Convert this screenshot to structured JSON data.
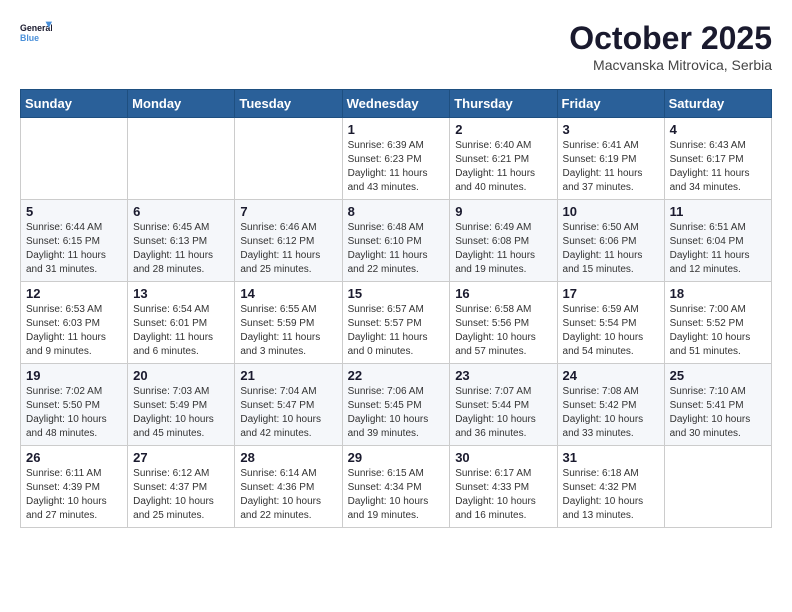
{
  "header": {
    "logo_line1": "General",
    "logo_line2": "Blue",
    "month": "October 2025",
    "location": "Macvanska Mitrovica, Serbia"
  },
  "weekdays": [
    "Sunday",
    "Monday",
    "Tuesday",
    "Wednesday",
    "Thursday",
    "Friday",
    "Saturday"
  ],
  "weeks": [
    [
      {
        "day": "",
        "info": ""
      },
      {
        "day": "",
        "info": ""
      },
      {
        "day": "",
        "info": ""
      },
      {
        "day": "1",
        "info": "Sunrise: 6:39 AM\nSunset: 6:23 PM\nDaylight: 11 hours\nand 43 minutes."
      },
      {
        "day": "2",
        "info": "Sunrise: 6:40 AM\nSunset: 6:21 PM\nDaylight: 11 hours\nand 40 minutes."
      },
      {
        "day": "3",
        "info": "Sunrise: 6:41 AM\nSunset: 6:19 PM\nDaylight: 11 hours\nand 37 minutes."
      },
      {
        "day": "4",
        "info": "Sunrise: 6:43 AM\nSunset: 6:17 PM\nDaylight: 11 hours\nand 34 minutes."
      }
    ],
    [
      {
        "day": "5",
        "info": "Sunrise: 6:44 AM\nSunset: 6:15 PM\nDaylight: 11 hours\nand 31 minutes."
      },
      {
        "day": "6",
        "info": "Sunrise: 6:45 AM\nSunset: 6:13 PM\nDaylight: 11 hours\nand 28 minutes."
      },
      {
        "day": "7",
        "info": "Sunrise: 6:46 AM\nSunset: 6:12 PM\nDaylight: 11 hours\nand 25 minutes."
      },
      {
        "day": "8",
        "info": "Sunrise: 6:48 AM\nSunset: 6:10 PM\nDaylight: 11 hours\nand 22 minutes."
      },
      {
        "day": "9",
        "info": "Sunrise: 6:49 AM\nSunset: 6:08 PM\nDaylight: 11 hours\nand 19 minutes."
      },
      {
        "day": "10",
        "info": "Sunrise: 6:50 AM\nSunset: 6:06 PM\nDaylight: 11 hours\nand 15 minutes."
      },
      {
        "day": "11",
        "info": "Sunrise: 6:51 AM\nSunset: 6:04 PM\nDaylight: 11 hours\nand 12 minutes."
      }
    ],
    [
      {
        "day": "12",
        "info": "Sunrise: 6:53 AM\nSunset: 6:03 PM\nDaylight: 11 hours\nand 9 minutes."
      },
      {
        "day": "13",
        "info": "Sunrise: 6:54 AM\nSunset: 6:01 PM\nDaylight: 11 hours\nand 6 minutes."
      },
      {
        "day": "14",
        "info": "Sunrise: 6:55 AM\nSunset: 5:59 PM\nDaylight: 11 hours\nand 3 minutes."
      },
      {
        "day": "15",
        "info": "Sunrise: 6:57 AM\nSunset: 5:57 PM\nDaylight: 11 hours\nand 0 minutes."
      },
      {
        "day": "16",
        "info": "Sunrise: 6:58 AM\nSunset: 5:56 PM\nDaylight: 10 hours\nand 57 minutes."
      },
      {
        "day": "17",
        "info": "Sunrise: 6:59 AM\nSunset: 5:54 PM\nDaylight: 10 hours\nand 54 minutes."
      },
      {
        "day": "18",
        "info": "Sunrise: 7:00 AM\nSunset: 5:52 PM\nDaylight: 10 hours\nand 51 minutes."
      }
    ],
    [
      {
        "day": "19",
        "info": "Sunrise: 7:02 AM\nSunset: 5:50 PM\nDaylight: 10 hours\nand 48 minutes."
      },
      {
        "day": "20",
        "info": "Sunrise: 7:03 AM\nSunset: 5:49 PM\nDaylight: 10 hours\nand 45 minutes."
      },
      {
        "day": "21",
        "info": "Sunrise: 7:04 AM\nSunset: 5:47 PM\nDaylight: 10 hours\nand 42 minutes."
      },
      {
        "day": "22",
        "info": "Sunrise: 7:06 AM\nSunset: 5:45 PM\nDaylight: 10 hours\nand 39 minutes."
      },
      {
        "day": "23",
        "info": "Sunrise: 7:07 AM\nSunset: 5:44 PM\nDaylight: 10 hours\nand 36 minutes."
      },
      {
        "day": "24",
        "info": "Sunrise: 7:08 AM\nSunset: 5:42 PM\nDaylight: 10 hours\nand 33 minutes."
      },
      {
        "day": "25",
        "info": "Sunrise: 7:10 AM\nSunset: 5:41 PM\nDaylight: 10 hours\nand 30 minutes."
      }
    ],
    [
      {
        "day": "26",
        "info": "Sunrise: 6:11 AM\nSunset: 4:39 PM\nDaylight: 10 hours\nand 27 minutes."
      },
      {
        "day": "27",
        "info": "Sunrise: 6:12 AM\nSunset: 4:37 PM\nDaylight: 10 hours\nand 25 minutes."
      },
      {
        "day": "28",
        "info": "Sunrise: 6:14 AM\nSunset: 4:36 PM\nDaylight: 10 hours\nand 22 minutes."
      },
      {
        "day": "29",
        "info": "Sunrise: 6:15 AM\nSunset: 4:34 PM\nDaylight: 10 hours\nand 19 minutes."
      },
      {
        "day": "30",
        "info": "Sunrise: 6:17 AM\nSunset: 4:33 PM\nDaylight: 10 hours\nand 16 minutes."
      },
      {
        "day": "31",
        "info": "Sunrise: 6:18 AM\nSunset: 4:32 PM\nDaylight: 10 hours\nand 13 minutes."
      },
      {
        "day": "",
        "info": ""
      }
    ]
  ]
}
